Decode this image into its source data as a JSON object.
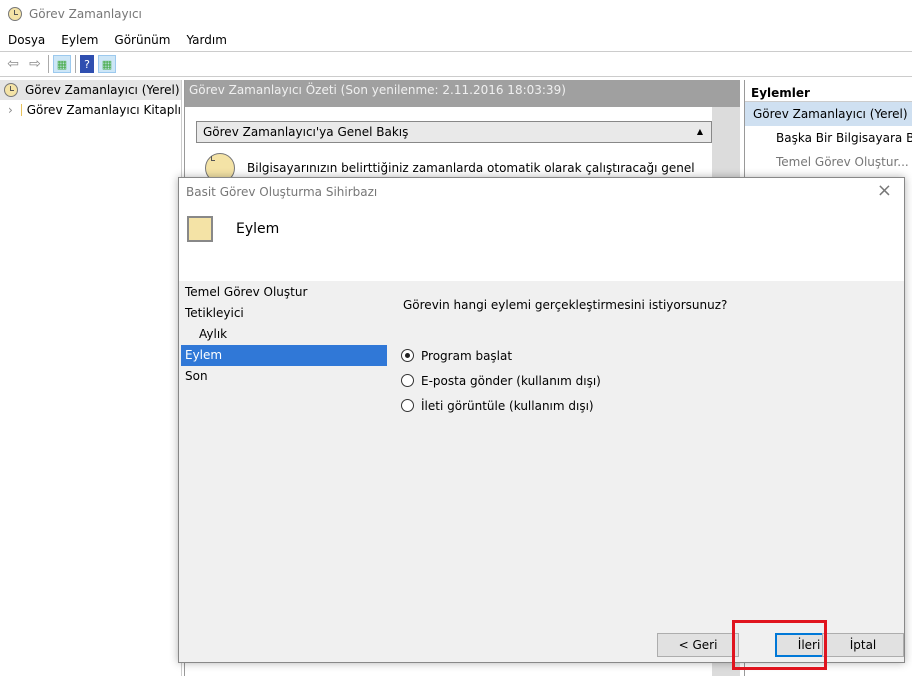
{
  "window": {
    "title": "Görev Zamanlayıcı"
  },
  "menu": [
    "Dosya",
    "Eylem",
    "Görünüm",
    "Yardım"
  ],
  "tree": [
    {
      "label": "Görev Zamanlayıcı (Yerel)"
    },
    {
      "label": "Görev Zamanlayıcı Kitaplı"
    }
  ],
  "center": {
    "header": "Görev Zamanlayıcı Özeti (Son yenilenme: 2.11.2016 18:03:39)",
    "section": "Görev Zamanlayıcı'ya Genel Bakış",
    "text": "Bilgisayarınızın belirttiğiniz zamanlarda otomatik olarak çalıştıracağı genel"
  },
  "actions": {
    "header": "Eylemler",
    "items": [
      "Görev Zamanlayıcı (Yerel)",
      "Başka Bir Bilgisayara Bağla",
      "Temel Görev Oluştur..."
    ]
  },
  "dialog": {
    "title": "Basit Görev Oluşturma Sihirbazı",
    "heading": "Eylem",
    "nav": [
      "Temel Görev Oluştur",
      "Tetikleyici",
      "Aylık",
      "Eylem",
      "Son"
    ],
    "question": "Görevin hangi eylemi gerçekleştirmesini istiyorsunuz?",
    "options": [
      {
        "label": "Program başlat",
        "selected": true
      },
      {
        "label": "E-posta gönder (kullanım dışı)",
        "selected": false
      },
      {
        "label": "İleti görüntüle (kullanım dışı)",
        "selected": false
      }
    ],
    "buttons": {
      "back": "< Geri",
      "next": "İleri >",
      "cancel": "İptal"
    },
    "highlight_color": "#e0141e"
  }
}
